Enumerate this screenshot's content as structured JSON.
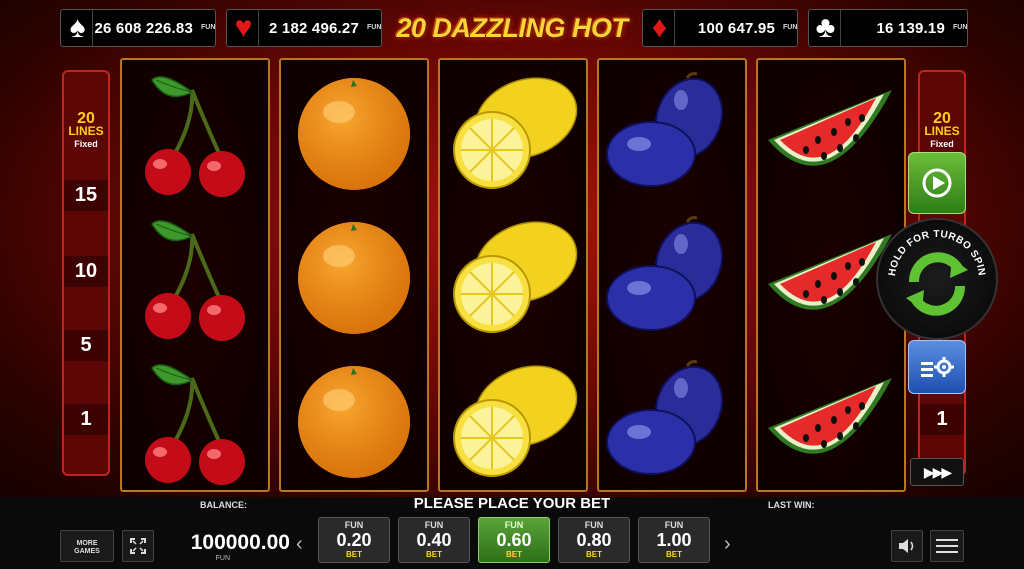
{
  "game": {
    "title": "20 DAZZLING HOT"
  },
  "jackpots": [
    {
      "suit": "spade",
      "glyph": "♠",
      "value": "26 608 226.83",
      "currency": "FUN"
    },
    {
      "suit": "heart",
      "glyph": "♥",
      "value": "2 182 496.27",
      "currency": "FUN"
    },
    {
      "suit": "diamond",
      "glyph": "♦",
      "value": "100 647.95",
      "currency": "FUN"
    },
    {
      "suit": "club",
      "glyph": "♣",
      "value": "16 139.19",
      "currency": "FUN"
    }
  ],
  "lines": {
    "count": "20",
    "label": "LINES",
    "mode": "Fixed",
    "markers": [
      "15",
      "10",
      "5",
      "1"
    ]
  },
  "reels": [
    [
      "cherry",
      "cherry",
      "cherry"
    ],
    [
      "orange",
      "orange",
      "orange"
    ],
    [
      "lemon",
      "lemon",
      "lemon"
    ],
    [
      "plum",
      "plum",
      "plum"
    ],
    [
      "watermelon",
      "watermelon",
      "watermelon"
    ]
  ],
  "controls": {
    "turbo_hint": "HOLD FOR TURBO SPIN",
    "play_icon": "play-icon",
    "settings_icon": "auto-settings-icon",
    "autoplay_label": "▶▶▶"
  },
  "bottom_bar": {
    "balance_label": "BALANCE:",
    "balance_value": "100000.00",
    "balance_currency": "FUN",
    "message": "PLEASE PLACE YOUR BET",
    "last_win_label": "LAST WIN:",
    "more_games_line1": "MORE",
    "more_games_line2": "GAMES",
    "bet_options": [
      {
        "currency": "FUN",
        "value": "0.20",
        "label": "BET",
        "selected": false
      },
      {
        "currency": "FUN",
        "value": "0.40",
        "label": "BET",
        "selected": false
      },
      {
        "currency": "FUN",
        "value": "0.60",
        "label": "BET",
        "selected": true
      },
      {
        "currency": "FUN",
        "value": "0.80",
        "label": "BET",
        "selected": false
      },
      {
        "currency": "FUN",
        "value": "1.00",
        "label": "BET",
        "selected": false
      }
    ]
  },
  "colors": {
    "accent_gold": "#ffd23a",
    "active_bet": "#5aa33a",
    "reel_frame": "#b8761f"
  }
}
